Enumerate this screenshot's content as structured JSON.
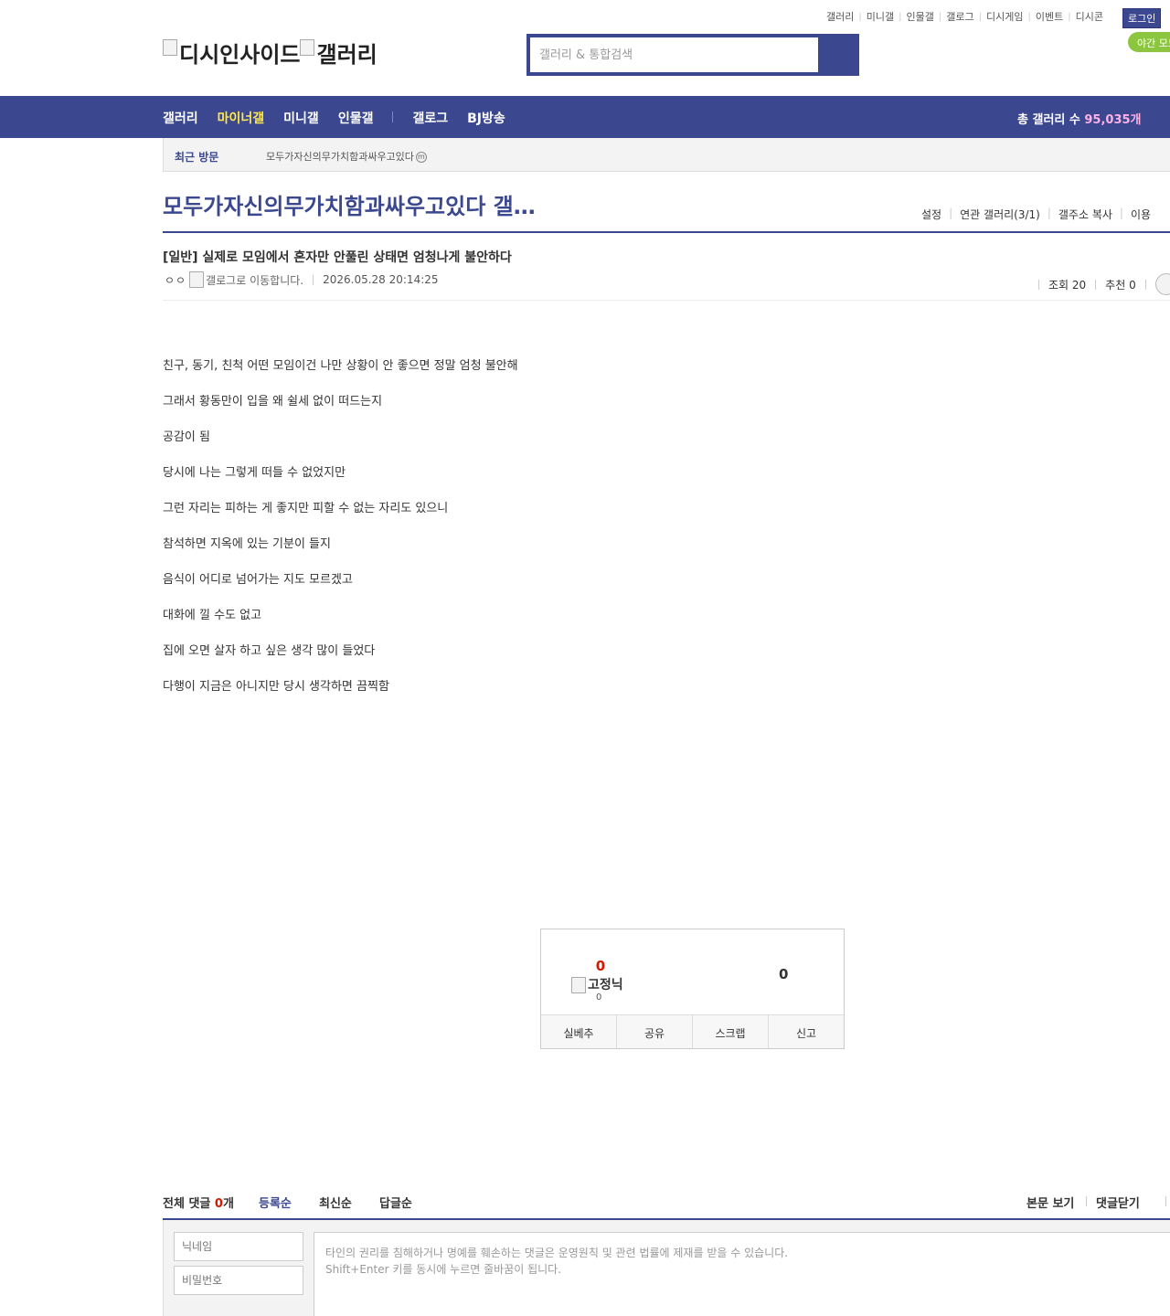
{
  "util_nav": [
    "갤러리",
    "미니갤",
    "인물갤",
    "갤로그",
    "디시게임",
    "이벤트",
    "디시콘"
  ],
  "login_label": "로그인",
  "night_mode_label": "야간 모드",
  "logo": {
    "site_alt": "디시인사이드",
    "gallery_alt": "갤러리"
  },
  "search": {
    "placeholder": "갤러리 & 통합검색"
  },
  "gnb": {
    "items": [
      "갤러리",
      "마이너갤",
      "미니갤",
      "인물갤"
    ],
    "items2": [
      "갤로그",
      "BJ방송"
    ],
    "total_label": "총 갤러리 수",
    "total_count": "95,035개"
  },
  "recent": {
    "title": "최근 방문",
    "item": "모두가자신의무가치함과싸우고있다",
    "mark": "m"
  },
  "gallery": {
    "title": "모두가자신의무가치함과싸우고있다 갤…",
    "tools": [
      "설정",
      "연관 갤러리(3/1)",
      "갤주소 복사",
      "이용"
    ]
  },
  "post": {
    "title": "[일반] 실제로 모임에서 혼자만 안풀린 상태면 엄청나게 불안하다",
    "writer": "ㅇㅇ",
    "gallog_alt": "갤로그로 이동합니다.",
    "date": "2026.05.28 20:14:25",
    "views": "조회 20",
    "recommend": "추천 0",
    "body": [
      "친구, 동기, 친척 어떤 모임이건 나만 상황이 안 좋으면 정말 엄청 불안해",
      "그래서 황동만이 입을 왜 쉴세 없이 떠드는지",
      "공감이 됨",
      "당시에 나는 그렇게 떠들 수 없었지만",
      "그런 자리는 피하는 게 좋지만 피할 수 없는 자리도 있으니",
      "참석하면 지옥에 있는 기분이 들지",
      "음식이 어디로 넘어가는 지도 모르겠고",
      "대화에 낄 수도 없고",
      "집에 오면 살자 하고 싶은 생각 많이 들었다",
      "다행이 지금은 아니지만 당시 생각하면 끔찍함"
    ]
  },
  "recommend_box": {
    "up_count": "0",
    "fixed_alt": "고정닉",
    "fixed_count": "0",
    "down_count": "0",
    "buttons": [
      "실베추",
      "공유",
      "스크랩",
      "신고"
    ]
  },
  "comments": {
    "total_prefix": "전체 댓글 ",
    "total_num": "0",
    "total_suffix": "개",
    "sorts": [
      "등록순",
      "최신순",
      "답글순"
    ],
    "view_body": "본문 보기",
    "close": "댓글닫기",
    "name_placeholder": "닉네임",
    "pw_placeholder": "비밀번호",
    "notice1": "타인의 권리를 침해하거나 명예를 훼손하는 댓글은 운영원칙 및 관련 법률에 제재를 받을 수 있습니다.",
    "notice2": "Shift+Enter 키를 동시에 누르면 줄바꿈이 됩니다."
  },
  "colors": {
    "brand": "#3b4890",
    "active_menu": "#ffe84a",
    "gallery_count": "#ffb1e7",
    "night_mode": "#8cc63e",
    "recommend_up": "#d31900"
  }
}
